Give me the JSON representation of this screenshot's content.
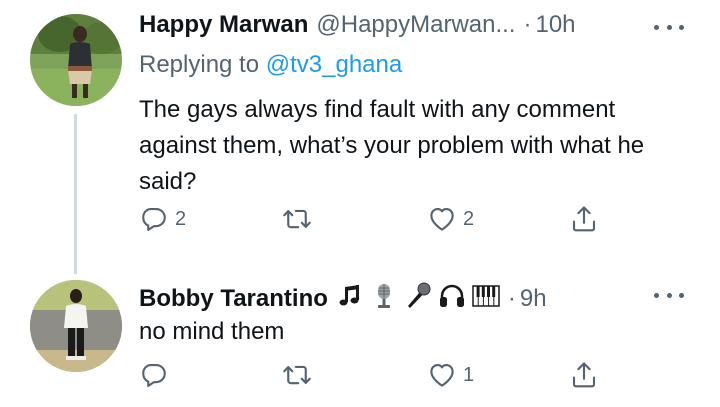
{
  "tweets": [
    {
      "author_name": "Happy Marwan",
      "author_handle": "@HappyMarwan...",
      "separator": "·",
      "time": "10h",
      "replying_prefix": "Replying to",
      "replying_handle": "@tv3_ghana",
      "text": "The gays always find fault with any comment against them, what’s your problem with what he said?",
      "reply_count": "2",
      "retweet_count": "",
      "like_count": "2"
    },
    {
      "author_name": "Bobby Tarantino",
      "name_emojis": [
        "musical-notes-icon",
        "studio-microphone-icon",
        "microphone-icon",
        "headphones-icon",
        "piano-keys-icon"
      ],
      "separator": "·",
      "time": "9h",
      "text": "no mind them",
      "reply_count": "",
      "retweet_count": "",
      "like_count": "1"
    }
  ],
  "colors": {
    "link": "#1d9bf0",
    "secondary_text": "#536471",
    "primary_text": "#0f1419",
    "thread_line": "#cfd9de"
  }
}
